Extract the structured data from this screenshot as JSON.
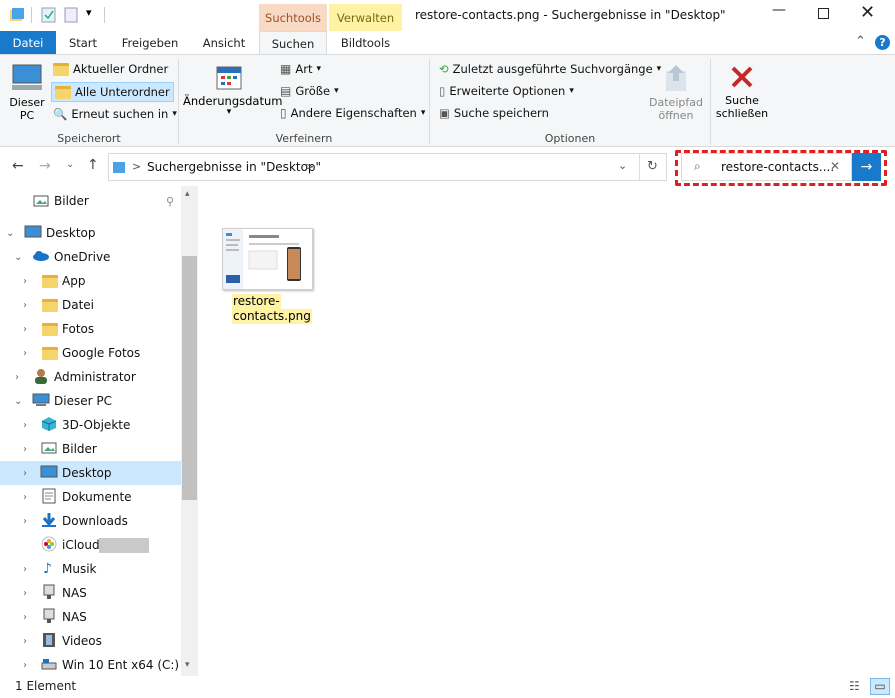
{
  "window": {
    "title": "restore-contacts.png - Suchergebnisse in \"Desktop\""
  },
  "ctx_tabs": {
    "suchtools": "Suchtools",
    "verwalten": "Verwalten"
  },
  "tabs": [
    "Datei",
    "Start",
    "Freigeben",
    "Ansicht",
    "Suchen",
    "Bildtools"
  ],
  "ribbon": {
    "speicherort": {
      "dieser_pc": "Dieser PC",
      "aktueller_ordner": "Aktueller Ordner",
      "alle_unterordner": "Alle Unterordner",
      "erneut_suchen": "Erneut suchen in",
      "label": "Speicherort"
    },
    "verfeinern": {
      "aenderungsdatum": "Änderungsdatum",
      "art": "Art",
      "groesse": "Größe",
      "andere": "Andere Eigenschaften",
      "label": "Verfeinern"
    },
    "optionen": {
      "zuletzt": "Zuletzt ausgeführte Suchvorgänge",
      "erweitert": "Erweiterte Optionen",
      "speichern": "Suche speichern",
      "dateipfad": "Dateipfad öffnen",
      "label": "Optionen"
    },
    "schliessen": "Suche schließen"
  },
  "address": {
    "path_prefix": ">",
    "path": "Suchergebnisse in \"Desktop\"",
    "path_suffix": ">"
  },
  "search": {
    "value": "restore-contacts...."
  },
  "sidebar": {
    "items": [
      {
        "label": "Bilder"
      },
      {
        "label": "Desktop"
      },
      {
        "label": "OneDrive"
      },
      {
        "label": "App"
      },
      {
        "label": "Datei"
      },
      {
        "label": "Fotos"
      },
      {
        "label": "Google Fotos"
      },
      {
        "label": "Administrator"
      },
      {
        "label": "Dieser PC"
      },
      {
        "label": "3D-Objekte"
      },
      {
        "label": "Bilder"
      },
      {
        "label": "Desktop"
      },
      {
        "label": "Dokumente"
      },
      {
        "label": "Downloads"
      },
      {
        "label": "iCloud"
      },
      {
        "label": "Musik"
      },
      {
        "label": "NAS"
      },
      {
        "label": "NAS"
      },
      {
        "label": "Videos"
      },
      {
        "label": "Win 10 Ent x64 (C:)"
      }
    ]
  },
  "file": {
    "name_line1": "restore-",
    "name_line2": "contacts.png"
  },
  "status": {
    "count": "1 Element"
  }
}
